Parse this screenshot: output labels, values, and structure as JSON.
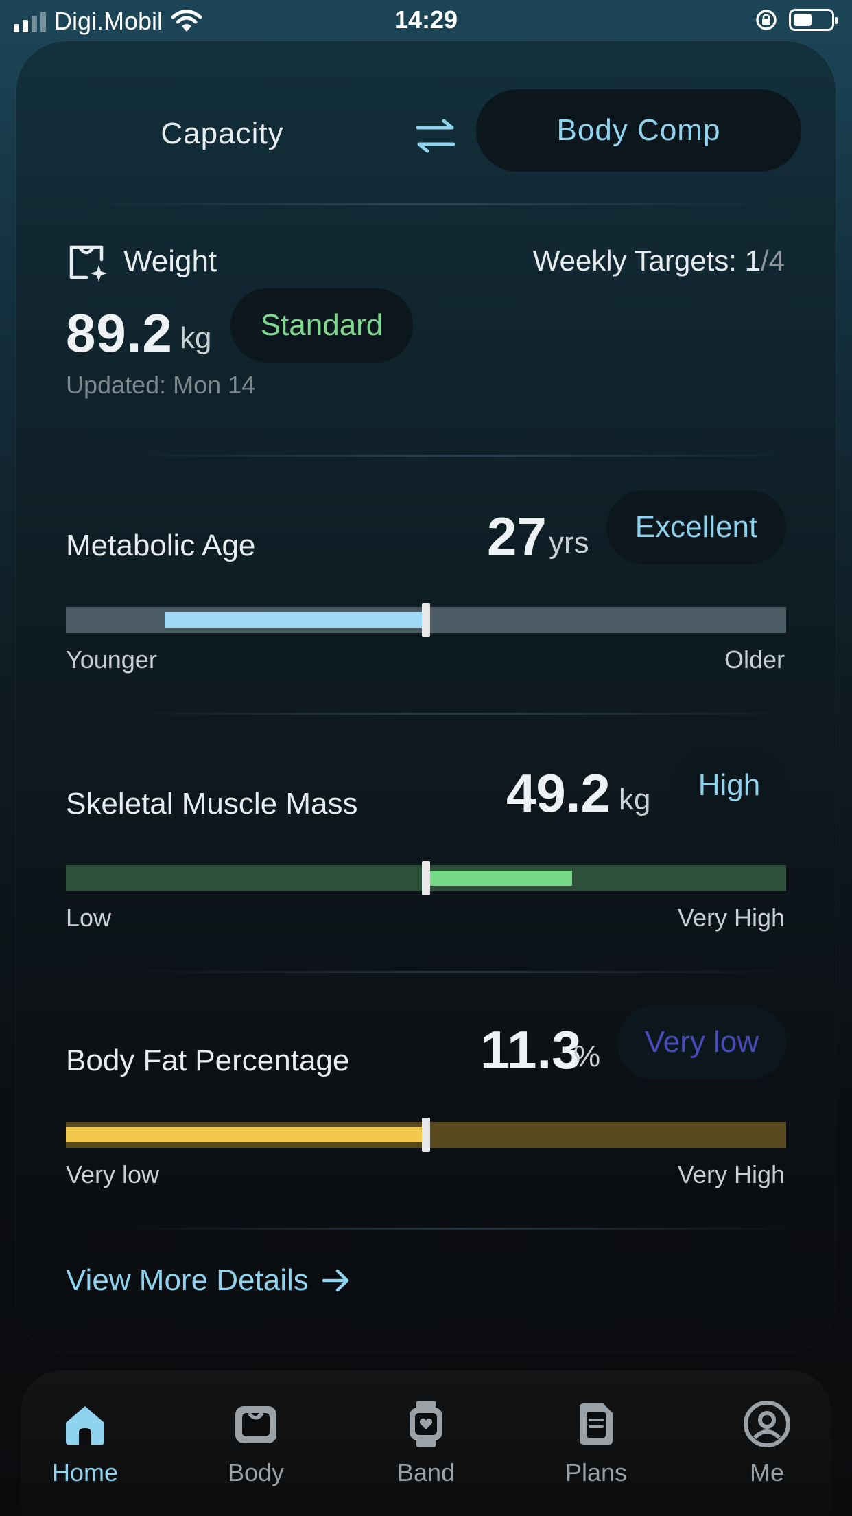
{
  "status_bar": {
    "carrier": "Digi.Mobil",
    "time": "14:29",
    "battery_level": 0.5
  },
  "toggle": {
    "left_label": "Capacity",
    "right_label": "Body Comp",
    "selected": "Body Comp"
  },
  "weight": {
    "label": "Weight",
    "weekly_prefix": "Weekly Targets:",
    "weekly_done": "1",
    "weekly_total": "/4",
    "value": "89.2",
    "unit": "kg",
    "status": "Standard",
    "updated": "Updated: Mon 14"
  },
  "metrics": [
    {
      "label": "Metabolic Age",
      "value": "27",
      "unit": "yrs",
      "status": "Excellent",
      "scale_left": "Younger",
      "scale_right": "Older",
      "fill_start": 0.137,
      "fill_end": 0.5,
      "marker": 0.5,
      "track_color": "#4b5c64",
      "fill_color": "#9ed8f5",
      "status_color": "#8fd3ef"
    },
    {
      "label": "Skeletal Muscle Mass",
      "value": "49.2",
      "unit": "kg",
      "status": "High",
      "scale_left": "Low",
      "scale_right": "Very High",
      "fill_start": 0.5,
      "fill_end": 0.703,
      "marker": 0.5,
      "track_color": "#2e5038",
      "fill_color": "#74d886",
      "status_color": "#8fd3ef"
    },
    {
      "label": "Body Fat Percentage",
      "value": "11.3",
      "unit": "%",
      "status": "Very low",
      "scale_left": "Very low",
      "scale_right": "Very High",
      "fill_start": 0.0,
      "fill_end": 0.5,
      "marker": 0.5,
      "track_color": "#5a4a1f",
      "fill_color": "#f2c94c",
      "status_color": "#4a49b8"
    }
  ],
  "view_more": {
    "label": "View More Details"
  },
  "nav": {
    "items": [
      {
        "label": "Home",
        "icon": "home-icon",
        "active": true
      },
      {
        "label": "Body",
        "icon": "body-icon",
        "active": false
      },
      {
        "label": "Band",
        "icon": "band-icon",
        "active": false
      },
      {
        "label": "Plans",
        "icon": "plans-icon",
        "active": false
      },
      {
        "label": "Me",
        "icon": "me-icon",
        "active": false
      }
    ]
  },
  "colors": {
    "accent": "#8fd3ef",
    "standard_green": "#7ed98f"
  }
}
